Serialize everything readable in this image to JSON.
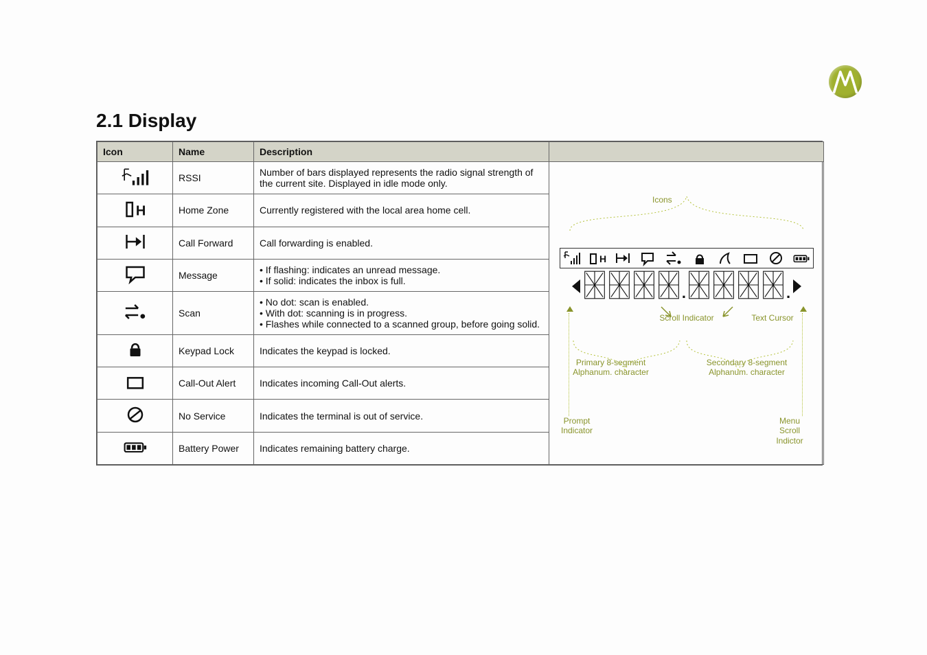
{
  "header": {
    "title": "2.1 Display",
    "logo_name": "motorola-logo"
  },
  "table": {
    "columns": [
      "Icon",
      "Name",
      "Description",
      ""
    ],
    "rows": [
      {
        "name": "RSSI",
        "desc": "Number of bars displayed represents the radio signal strength of the current site. Displayed in idle mode only."
      },
      {
        "name": "Home Zone",
        "desc": "Currently registered with the local area home cell."
      },
      {
        "name": "Call Forward",
        "desc": "Call forwarding is enabled."
      },
      {
        "name": "Message",
        "desc": "• If flashing: indicates an unread message.\n• If solid: indicates the inbox is full."
      },
      {
        "name": "Scan",
        "desc": "• No dot: scan is enabled.\n• With dot: scanning is in progress.\n• Flashes while connected to a scanned group, before going solid."
      },
      {
        "name": "Keypad Lock",
        "desc": "Indicates the keypad is locked."
      },
      {
        "name": "Call-Out Alert",
        "desc": "Indicates incoming Call-Out alerts."
      },
      {
        "name": "No Service",
        "desc": "Indicates the terminal is out of service."
      },
      {
        "name": "Battery Power",
        "desc": "Indicates remaining battery charge."
      }
    ]
  },
  "diagram": {
    "label_icons": "Icons",
    "label_scroll": "Scroll Indicator",
    "label_cursor": "Text Cursor",
    "label_primary_l1": "Primary 8-segment",
    "label_primary_l2": "Alphanum. character",
    "label_secondary_l1": "Secondary 8-segment",
    "label_secondary_l2": "Alphanum. character",
    "label_prompt_l1": "Prompt",
    "label_prompt_l2": "Indicator",
    "label_menuscroll_l1": "Menu Scroll",
    "label_menuscroll_l2": "Indictor"
  }
}
